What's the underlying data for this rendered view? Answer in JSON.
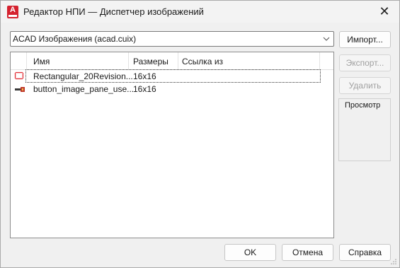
{
  "window": {
    "title": "Редактор НПИ — Диспетчер изображений",
    "app_icon_letter": "A"
  },
  "source_select": {
    "value": "ACAD Изображения (acad.cuix)"
  },
  "image_list": {
    "columns": [
      "Имя",
      "Размеры",
      "Ссылка из"
    ],
    "rows": [
      {
        "name": "Rectangular_20Revision...",
        "size": "16x16",
        "ref": "",
        "icon": "revision-cloud-icon",
        "selected": true
      },
      {
        "name": "button_image_pane_use...",
        "size": "16x16",
        "ref": "",
        "icon": "pane-tool-icon",
        "selected": false
      }
    ]
  },
  "side_buttons": {
    "import": "Импорт...",
    "export": "Экспорт...",
    "delete": "Удалить"
  },
  "preview": {
    "label": "Просмотр"
  },
  "footer": {
    "ok": "OK",
    "cancel": "Отмена",
    "help": "Справка"
  },
  "colors": {
    "app_icon": "#d5212e",
    "revision_cloud": "#e0242c",
    "disabled_text": "#a0a0a0"
  }
}
